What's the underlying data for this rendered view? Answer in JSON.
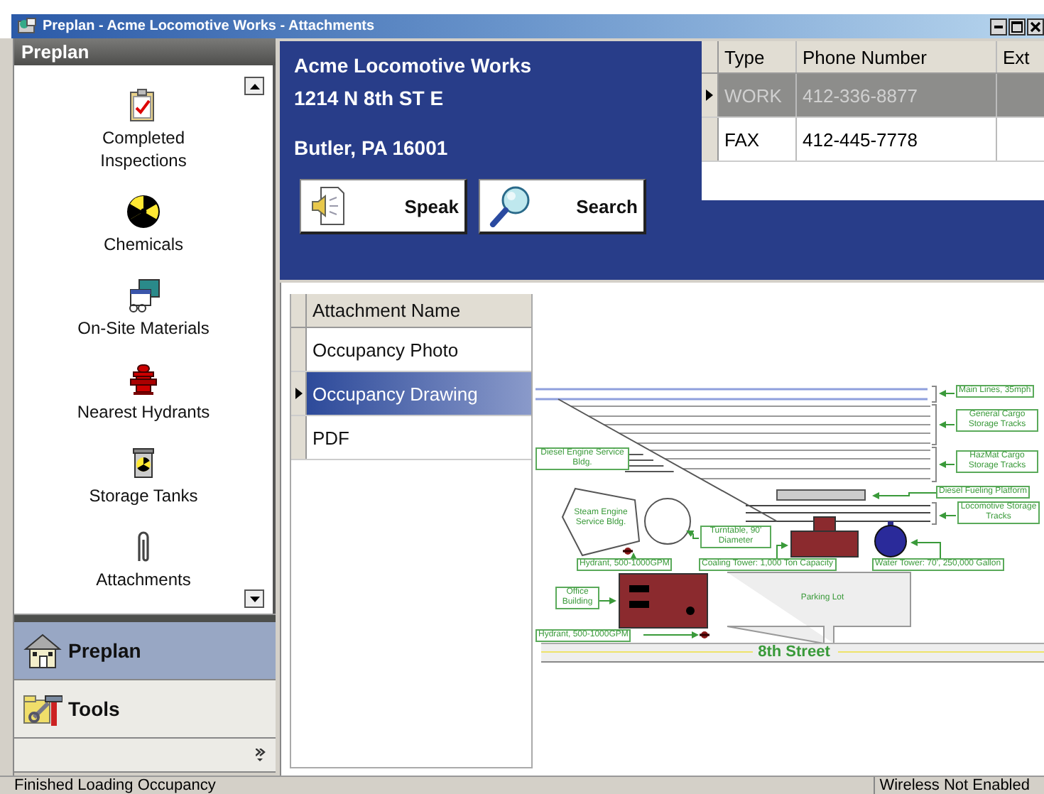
{
  "window": {
    "title": "Preplan - Acme Locomotive Works - Attachments"
  },
  "sidebar": {
    "header": "Preplan",
    "items": [
      {
        "label": "Completed Inspections"
      },
      {
        "label": "Chemicals"
      },
      {
        "label": "On-Site Materials"
      },
      {
        "label": "Nearest Hydrants"
      },
      {
        "label": "Storage Tanks"
      },
      {
        "label": "Attachments"
      }
    ],
    "nav_buttons": [
      {
        "label": "Preplan",
        "selected": true
      },
      {
        "label": "Tools",
        "selected": false
      }
    ]
  },
  "contact": {
    "name": "Acme Locomotive Works",
    "address": "1214 N 8th ST E",
    "city_line": "Butler, PA 16001"
  },
  "phones": {
    "columns": [
      "Type",
      "Phone Number",
      "Ext"
    ],
    "rows": [
      {
        "type": "WORK",
        "number": "412-336-8877",
        "selected": true
      },
      {
        "type": "FAX",
        "number": "412-445-7778",
        "selected": false
      }
    ]
  },
  "buttons": [
    {
      "label": "Speak"
    },
    {
      "label": "Search"
    }
  ],
  "attachments": {
    "column": "Attachment Name",
    "rows": [
      {
        "name": "Occupancy Photo",
        "selected": false
      },
      {
        "name": "Occupancy Drawing",
        "selected": true
      },
      {
        "name": "PDF",
        "selected": false
      }
    ]
  },
  "site_map": {
    "labels": [
      "Main Lines, 35mph",
      "General Cargo Storage Tracks",
      "Diesel Engine Service Bldg.",
      "HazMat Cargo Storage Tracks",
      "Diesel Fueling Platform",
      "Locomotive Storage Tracks",
      "Steam Engine Service Bldg.",
      "Turntable, 90' Diameter",
      "Hydrant, 500-1000GPM",
      "Coaling Tower: 1,000 Ton Capacity",
      "Water Tower: 70', 250,000 Gallon",
      "Office Building",
      "Parking Lot",
      "Hydrant, 500-1000GPM",
      "8th Street"
    ]
  },
  "status_bar": {
    "message": "Finished Loading Occupancy",
    "wireless": "Wireless Not Enabled"
  }
}
